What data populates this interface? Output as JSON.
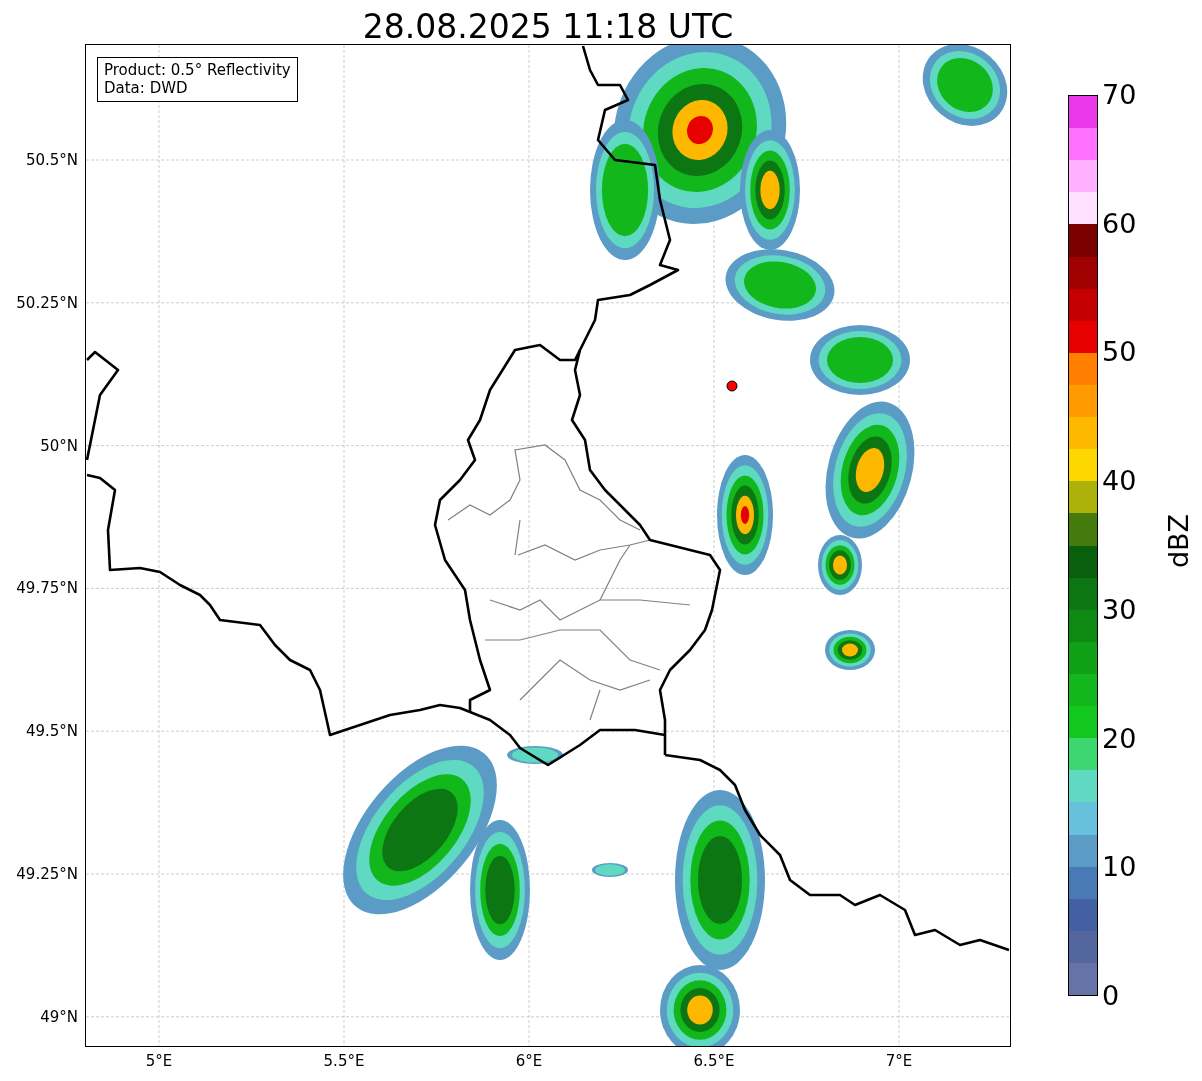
{
  "title": "28.08.2025 11:18 UTC",
  "map": {
    "legend": [
      "Product: 0.5° Reflectivity",
      "Data: DWD"
    ],
    "lat_ticks": [
      "50.5°N",
      "50.25°N",
      "50°N",
      "49.75°N",
      "49.5°N",
      "49.25°N",
      "49°N"
    ],
    "lon_ticks": [
      "5°E",
      "5.5°E",
      "6°E",
      "6.5°E",
      "7°E"
    ]
  },
  "colorbar": {
    "label": "dBZ",
    "ticks": [
      "70",
      "60",
      "50",
      "40",
      "30",
      "20",
      "10",
      "0"
    ],
    "segments": [
      {
        "color": "#6673a6"
      },
      {
        "color": "#53679e"
      },
      {
        "color": "#4260a3"
      },
      {
        "color": "#4a7ab5"
      },
      {
        "color": "#5a9cc5"
      },
      {
        "color": "#67c0dc"
      },
      {
        "color": "#5fd9c1"
      },
      {
        "color": "#3dd771"
      },
      {
        "color": "#12c71d"
      },
      {
        "color": "#12b81b"
      },
      {
        "color": "#10a016"
      },
      {
        "color": "#0e8a13"
      },
      {
        "color": "#0c7612"
      },
      {
        "color": "#0a5f0e"
      },
      {
        "color": "#457a0c"
      },
      {
        "color": "#adb20b"
      },
      {
        "color": "#ffd700"
      },
      {
        "color": "#ffb800"
      },
      {
        "color": "#ff9a00"
      },
      {
        "color": "#ff7f00"
      },
      {
        "color": "#e60000"
      },
      {
        "color": "#c40000"
      },
      {
        "color": "#a00000"
      },
      {
        "color": "#7a0000"
      },
      {
        "color": "#ffe0ff"
      },
      {
        "color": "#ffb0ff"
      },
      {
        "color": "#ff70ff"
      },
      {
        "color": "#e838e8"
      }
    ]
  }
}
